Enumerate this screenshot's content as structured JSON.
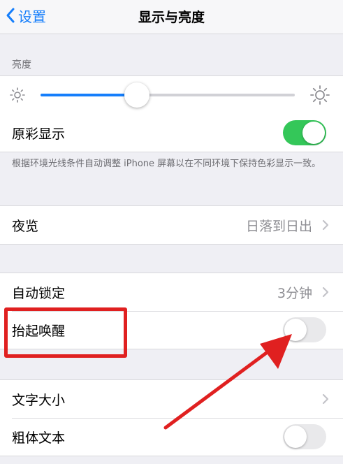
{
  "nav": {
    "back_label": "设置",
    "title": "显示与亮度"
  },
  "brightness": {
    "header": "亮度",
    "level_percent": 38
  },
  "true_tone": {
    "label": "原彩显示",
    "enabled": true,
    "note": "根据环境光线条件自动调整 iPhone 屏幕以在不同环境下保持色彩显示一致。"
  },
  "night_shift": {
    "label": "夜览",
    "value": "日落到日出"
  },
  "auto_lock": {
    "label": "自动锁定",
    "value": "3分钟"
  },
  "raise_to_wake": {
    "label": "抬起唤醒",
    "enabled": false
  },
  "text_size": {
    "label": "文字大小"
  },
  "bold_text": {
    "label": "粗体文本",
    "enabled": false
  },
  "colors": {
    "accent": "#157efb",
    "toggle_on": "#34c759",
    "annotation": "#e02020"
  }
}
